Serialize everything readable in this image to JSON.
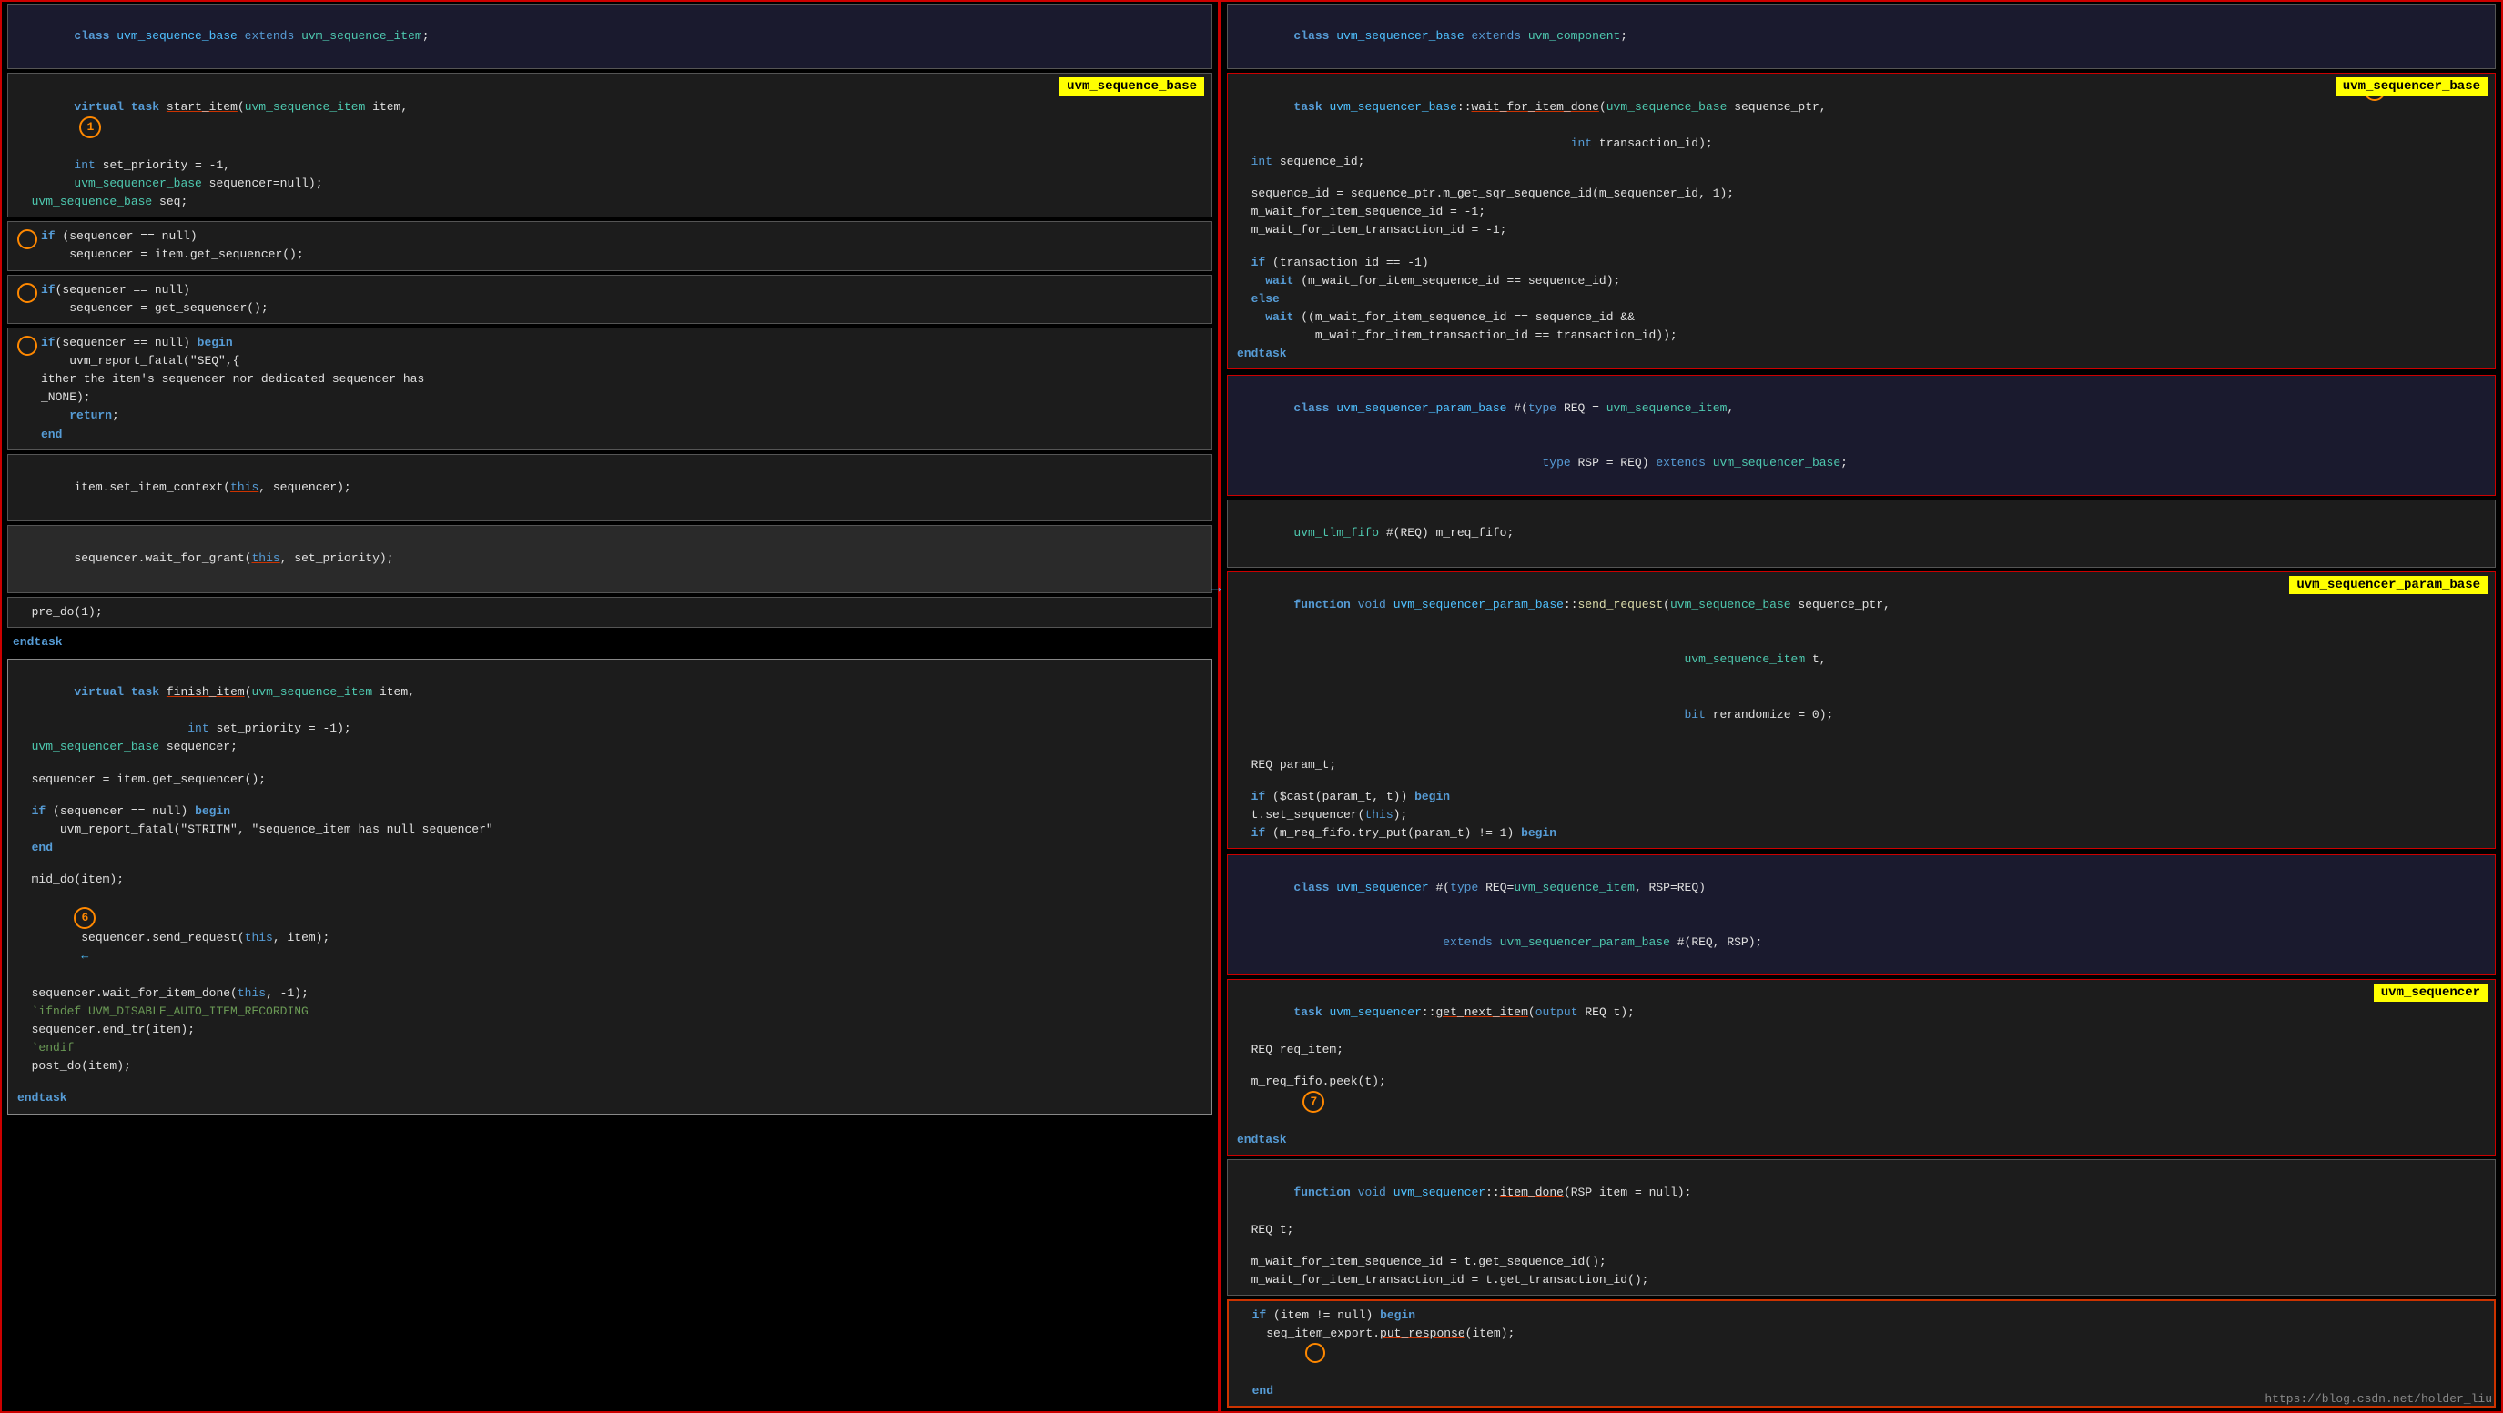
{
  "left": {
    "class_header": "class uvm_sequence_base extends uvm_sequence_item;",
    "blocks": [
      {
        "id": "start_item_block",
        "lines": [
          "virtual task start_item(uvm_sequence_item item,",
          "              int set_priority = -1,",
          "              uvm_sequencer_base sequencer=null);",
          "  uvm_sequence_base seq;"
        ],
        "label": "uvm_sequence_base",
        "circle": "1"
      },
      {
        "id": "if_block_1",
        "lines": [
          "if (sequencer == null)",
          "    sequencer = item.get_sequencer();"
        ]
      },
      {
        "id": "if_block_2",
        "lines": [
          "if(sequencer == null)",
          "    sequencer = get_sequencer();"
        ]
      },
      {
        "id": "if_block_3",
        "lines": [
          "if(sequencer == null) begin",
          "    uvm_report_fatal(\"SEQ\",{",
          "ither the item's sequencer nor dedicated sequencer has",
          "_NONE);",
          "    return;",
          "end"
        ]
      },
      {
        "id": "set_item_context",
        "lines": [
          "item.set_item_context(this, sequencer);"
        ]
      },
      {
        "id": "wait_for_grant",
        "lines": [
          "sequencer.wait_for_grant(this, set_priority);"
        ]
      },
      {
        "id": "pre_do",
        "lines": [
          "  pre_do(1);"
        ]
      },
      {
        "id": "endtask_1",
        "lines": [
          "endtask"
        ]
      }
    ],
    "finish_item_block": {
      "header": "virtual task finish_item(uvm_sequence_item item,",
      "header2": "                        int set_priority = -1);",
      "lines": [
        "  uvm_sequencer_base sequencer;",
        "",
        "  sequencer = item.get_sequencer();",
        "",
        "  if (sequencer == null) begin",
        "      uvm_report_fatal(\"STRITM\", \"sequence_item has null sequencer\"",
        "  end",
        "",
        "  mid_do(item);",
        "  sequencer.send_request(this, item);",
        "  sequencer.wait_for_item_done(this, -1);",
        "  `ifndef UVM_DISABLE_AUTO_ITEM_RECORDING",
        "  sequencer.end_tr(item);",
        "  `endif",
        "  post_do(item);",
        "",
        "endtask"
      ],
      "circle6": "6"
    }
  },
  "right": {
    "class_header_1": "class uvm_sequencer_base extends uvm_component;",
    "wait_for_item_done_block": {
      "header": "task uvm_sequencer_base::wait_for_item_done(uvm_sequence_base sequence_ptr,",
      "header2": "                                               int transaction_id);",
      "lines": [
        "  int sequence_id;",
        "",
        "  sequence_id = sequence_ptr.m_get_sqr_sequence_id(m_sequencer_id, 1);",
        "  m_wait_for_item_sequence_id = -1;",
        "  m_wait_for_item_transaction_id = -1;",
        "",
        "  if (transaction_id == -1)",
        "    wait (m_wait_for_item_sequence_id == sequence_id);",
        "  else",
        "    wait ((m_wait_for_item_sequence_id == sequence_id &&",
        "           m_wait_for_item_transaction_id == transaction_id));",
        "endtask"
      ],
      "label": "uvm_sequencer_base",
      "circle8": "8"
    },
    "param_base_class": {
      "header": "class uvm_sequencer_param_base #(type REQ = uvm_sequence_item,",
      "header2": "                                   type RSP = REQ) extends uvm_sequencer_base;"
    },
    "tlm_fifo": "uvm_tlm_fifo #(REQ) m_req_fifo;",
    "send_request_block": {
      "header": "function void uvm_sequencer_param_base::send_request(uvm_sequence_base sequence_ptr,",
      "header2": "                                                       uvm_sequence_item t,",
      "header3": "                                                       bit rerandomize = 0);",
      "lines": [
        "  REQ param_t;",
        "",
        "  if ($cast(param_t, t)) begin",
        "  t.set_sequencer(this);",
        "  if (m_req_fifo.try_put(param_t) != 1) begin"
      ],
      "label": "uvm_sequencer_param_base"
    },
    "sequencer_class": {
      "header": "class uvm_sequencer #(type REQ=uvm_sequence_item, RSP=REQ)",
      "header2": "                     extends uvm_sequencer_param_base #(REQ, RSP);"
    },
    "get_next_item_block": {
      "header": "task uvm_sequencer::get_next_item(output REQ t);",
      "lines": [
        "  REQ req_item;",
        "",
        "  m_req_fifo.peek(t);",
        "endtask"
      ],
      "circle7": "7",
      "label": "uvm_sequencer"
    },
    "item_done_block": {
      "header": "function void uvm_sequencer::item_done(RSP item = null);",
      "lines": [
        "  REQ t;",
        "",
        "  m_wait_for_item_sequence_id = t.get_sequence_id();",
        "  m_wait_for_item_transaction_id = t.get_transaction_id();"
      ]
    },
    "if_item_null_block": {
      "lines": [
        "  if (item != null) begin",
        "    seq_item_export.put_response(item);",
        "  end"
      ]
    }
  },
  "watermark": "https://blog.csdn.net/holder_liu"
}
